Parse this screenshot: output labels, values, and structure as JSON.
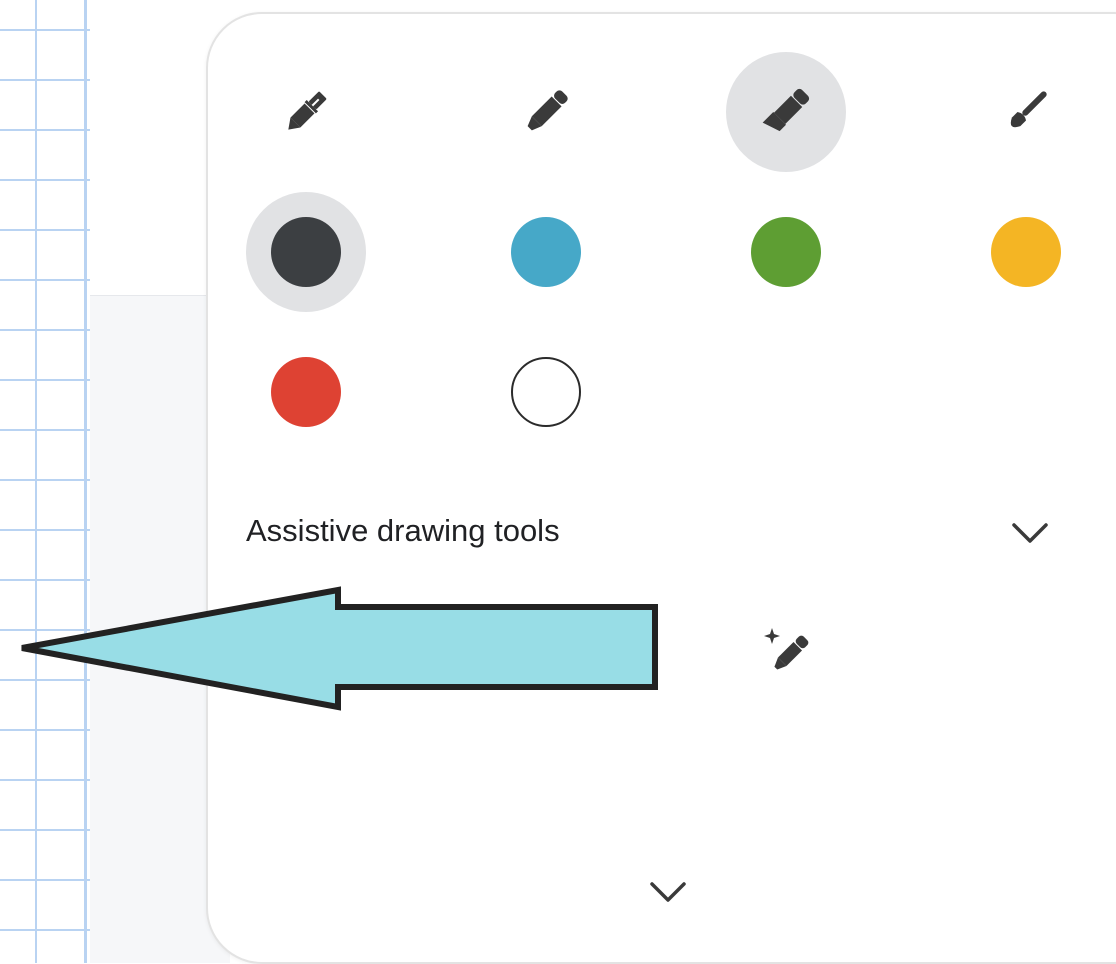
{
  "tools": [
    {
      "name": "pen",
      "icon": "pen-icon",
      "selected": false
    },
    {
      "name": "marker",
      "icon": "marker-icon",
      "selected": false
    },
    {
      "name": "highlighter",
      "icon": "highlighter-icon",
      "selected": true
    },
    {
      "name": "brush",
      "icon": "brush-icon",
      "selected": false
    }
  ],
  "colors": [
    {
      "name": "black",
      "hex": "#3c3f42",
      "selected": true
    },
    {
      "name": "blue",
      "hex": "#46a8c8",
      "selected": false
    },
    {
      "name": "green",
      "hex": "#5e9e33",
      "selected": false
    },
    {
      "name": "yellow",
      "hex": "#f4b524",
      "selected": false
    },
    {
      "name": "red",
      "hex": "#de4233",
      "selected": false
    },
    {
      "name": "white",
      "hex": "#ffffff",
      "selected": false
    }
  ],
  "assistive": {
    "label": "Assistive drawing tools",
    "toggle_icon": "chevron-down-icon",
    "tool_icon": "magic-pen-icon"
  },
  "footer": {
    "toggle_icon": "chevron-down-icon"
  },
  "annotation": {
    "arrow_fill": "#98dde6",
    "arrow_stroke": "#222222"
  }
}
